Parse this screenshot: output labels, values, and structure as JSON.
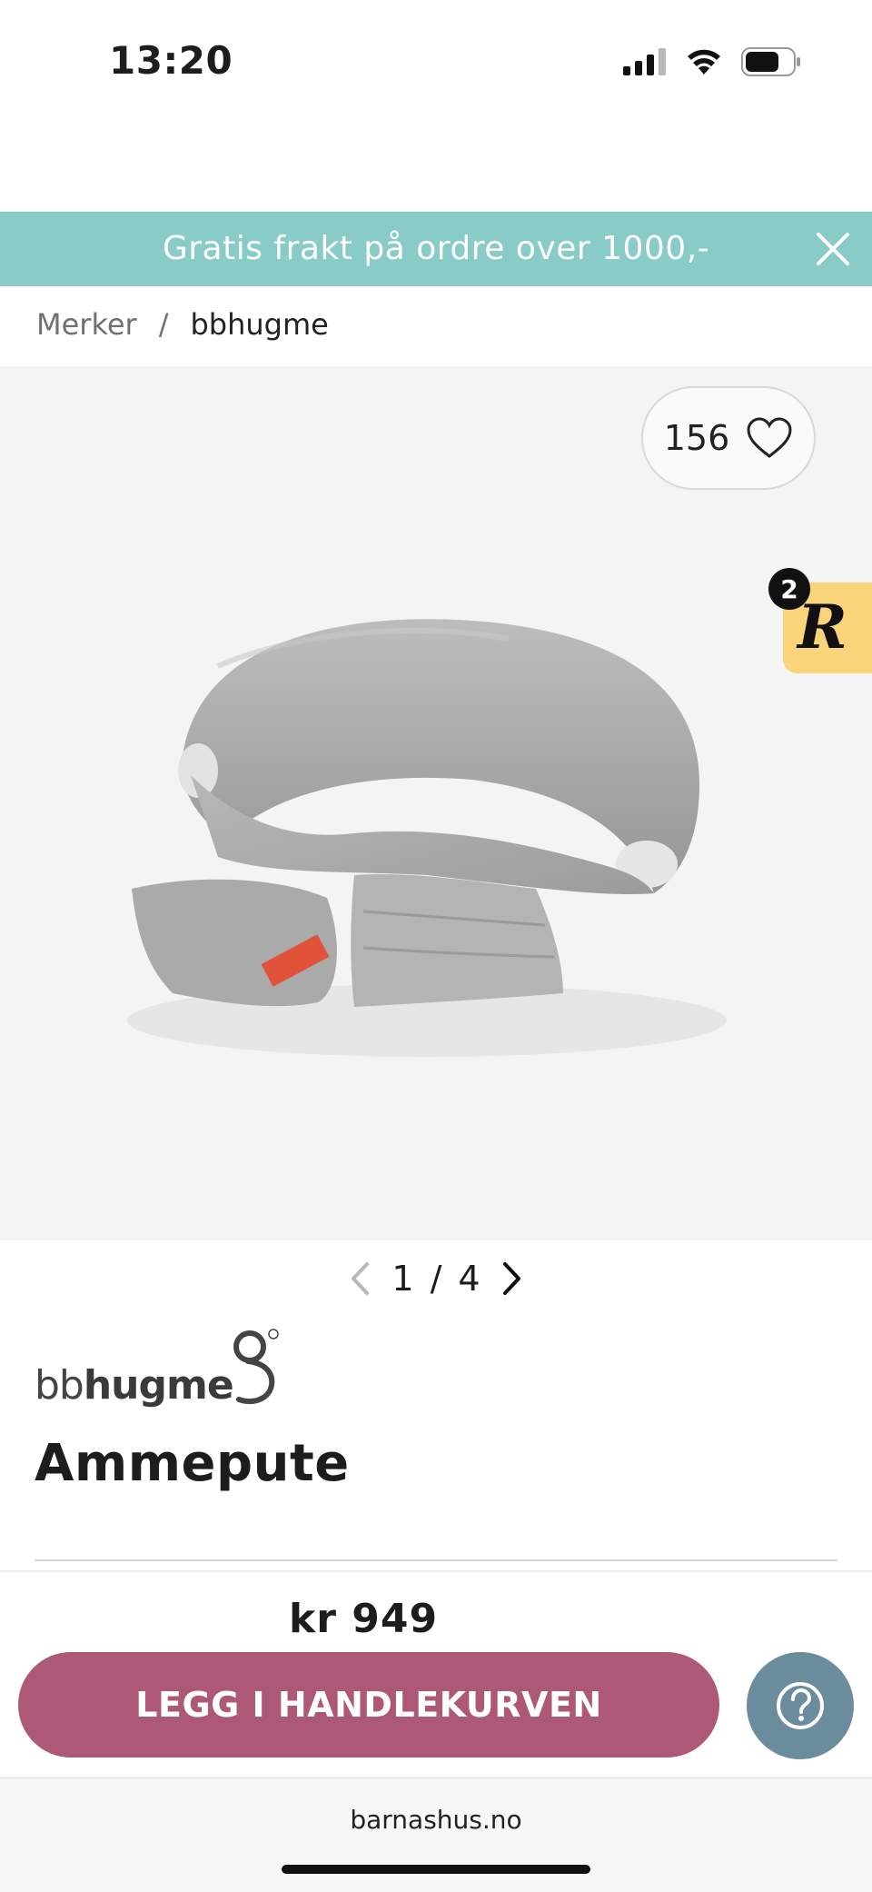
{
  "status_bar": {
    "time": "13:20"
  },
  "promo_banner": {
    "text": "Gratis frakt på ordre over 1000,-"
  },
  "breadcrumb": {
    "items": [
      "Merker",
      "bbhugme"
    ],
    "separator": "/"
  },
  "gallery": {
    "favorites_count": "156",
    "rewards_badge_count": "2",
    "rewards_letter": "R",
    "pagination": {
      "current": "1",
      "separator": "/",
      "total": "4"
    }
  },
  "brand": {
    "logo_text_light": "bb",
    "logo_text_bold": "hugme"
  },
  "product": {
    "title": "Ammepute",
    "price": "kr 949"
  },
  "actions": {
    "add_to_cart_label": "LEGG I HANDLEKURVEN"
  },
  "browser": {
    "url": "barnashus.no"
  },
  "colors": {
    "promo_bg": "#89cbc6",
    "cta_bg": "#ad5876",
    "help_bg": "#6b8c9c",
    "rewards_bg": "#f9d47a"
  }
}
